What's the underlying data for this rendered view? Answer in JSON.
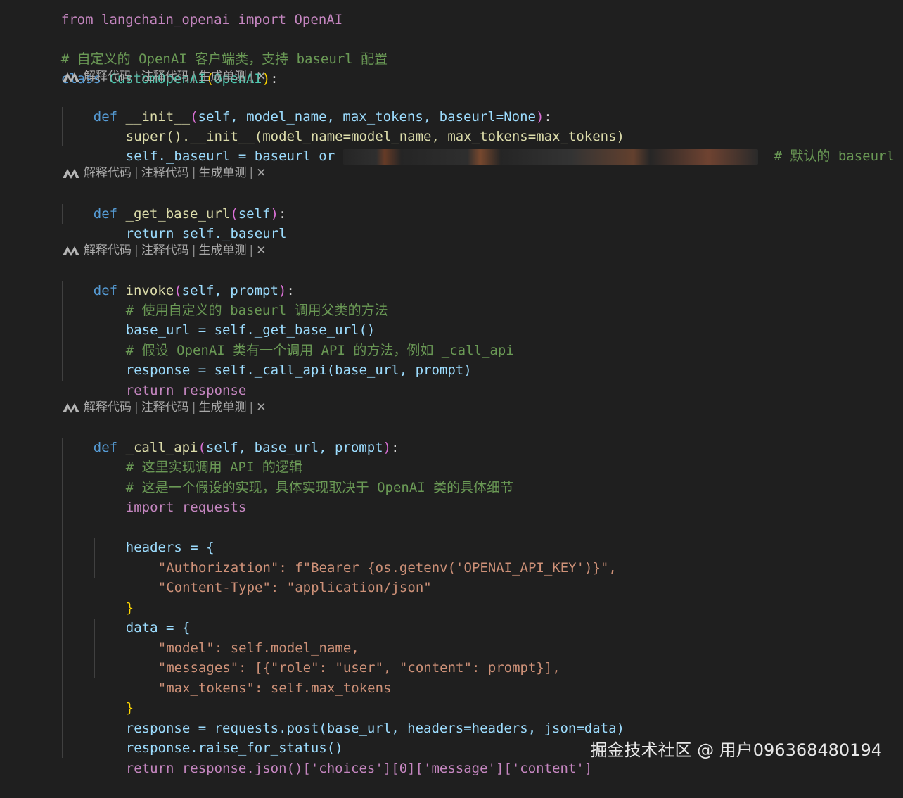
{
  "code": {
    "line_import": "from langchain_openai import OpenAI",
    "cm_class": "# 自定义的 OpenAI 客户端类，支持 baseurl 配置",
    "class_kw": "class",
    "class_name": "CustomOpenAI",
    "class_base": "OpenAI",
    "codelens": {
      "explain": "解释代码",
      "comment": "注释代码",
      "test": "生成单测",
      "sep": "|",
      "close": "✕"
    },
    "init": {
      "def": "def",
      "name": "__init__",
      "params": "self, model_name, max_tokens, baseurl=None",
      "super_call": "super().__init__(model_name=model_name, max_tokens=max_tokens)",
      "assign": "self._baseurl = baseurl or",
      "comment": "# 默认的 baseurl"
    },
    "getbase": {
      "def": "def",
      "name": "_get_base_url",
      "params": "self",
      "ret": "return self._baseurl"
    },
    "invoke": {
      "def": "def",
      "name": "invoke",
      "params": "self, prompt",
      "cm1": "# 使用自定义的 baseurl 调用父类的方法",
      "l1": "base_url = self._get_base_url()",
      "cm2": "# 假设 OpenAI 类有一个调用 API 的方法，例如 _call_api",
      "l2": "response = self._call_api(base_url, prompt)",
      "l3": "return response"
    },
    "callapi": {
      "def": "def",
      "name": "_call_api",
      "params": "self, base_url, prompt",
      "cm1": "# 这里实现调用 API 的逻辑",
      "cm2": "# 这是一个假设的实现，具体实现取决于 OpenAI 类的具体细节",
      "imp": "import requests",
      "headers_open": "headers = {",
      "h1": "\"Authorization\": f\"Bearer {os.getenv('OPENAI_API_KEY')}\",",
      "h2": "\"Content-Type\": \"application/json\"",
      "close1": "}",
      "data_open": "data = {",
      "d1": "\"model\": self.model_name,",
      "d2": "\"messages\": [{\"role\": \"user\", \"content\": prompt}],",
      "d3": "\"max_tokens\": self.max_tokens",
      "close2": "}",
      "post": "response = requests.post(base_url, headers=headers, json=data)",
      "raise": "response.raise_for_status()",
      "ret": "return response.json()['choices'][0]['message']['content']"
    }
  },
  "watermark": "掘金技术社区 @ 用户096368480194",
  "colors": {
    "background": "#1f1f1f",
    "keyword": "#569cd6",
    "control": "#c586c0",
    "class": "#4ec9b0",
    "function": "#dcdcaa",
    "variable": "#9cdcfe",
    "string": "#ce9178",
    "comment": "#6a9955"
  }
}
